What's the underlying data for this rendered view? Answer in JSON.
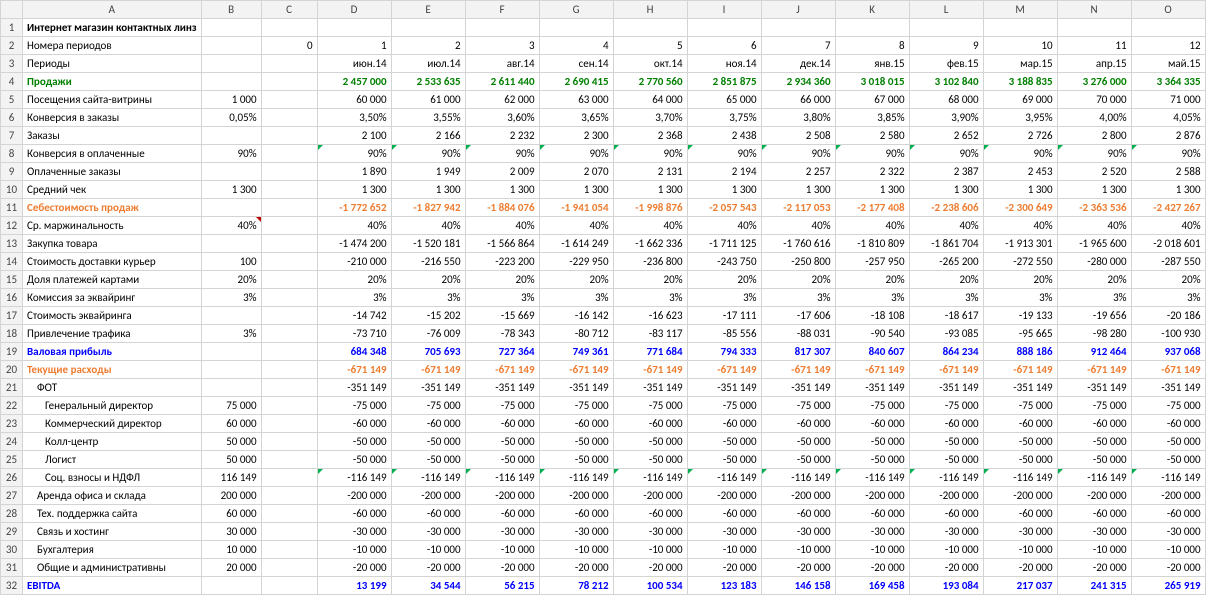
{
  "columns": [
    "",
    "A",
    "B",
    "C",
    "D",
    "E",
    "F",
    "G",
    "H",
    "I",
    "J",
    "K",
    "L",
    "M",
    "N",
    "O"
  ],
  "rows": {
    "1": {
      "A": "Интернет магазин контактных линз"
    },
    "2": {
      "A": "Номера периодов",
      "C": "0",
      "D": "1",
      "E": "2",
      "F": "3",
      "G": "4",
      "H": "5",
      "I": "6",
      "J": "7",
      "K": "8",
      "L": "9",
      "M": "10",
      "N": "11",
      "O": "12"
    },
    "3": {
      "A": "Периоды",
      "D": "июн.14",
      "E": "июл.14",
      "F": "авг.14",
      "G": "сен.14",
      "H": "окт.14",
      "I": "ноя.14",
      "J": "дек.14",
      "K": "янв.15",
      "L": "фев.15",
      "M": "мар.15",
      "N": "апр.15",
      "O": "май.15"
    },
    "4": {
      "A": "Продажи",
      "D": "2 457 000",
      "E": "2 533 635",
      "F": "2 611 440",
      "G": "2 690 415",
      "H": "2 770 560",
      "I": "2 851 875",
      "J": "2 934 360",
      "K": "3 018 015",
      "L": "3 102 840",
      "M": "3 188 835",
      "N": "3 276 000",
      "O": "3 364 335"
    },
    "5": {
      "A": "Посещения сайта-витрины",
      "B": "1 000",
      "D": "60 000",
      "E": "61 000",
      "F": "62 000",
      "G": "63 000",
      "H": "64 000",
      "I": "65 000",
      "J": "66 000",
      "K": "67 000",
      "L": "68 000",
      "M": "69 000",
      "N": "70 000",
      "O": "71 000"
    },
    "6": {
      "A": "Конверсия в заказы",
      "B": "0,05%",
      "D": "3,50%",
      "E": "3,55%",
      "F": "3,60%",
      "G": "3,65%",
      "H": "3,70%",
      "I": "3,75%",
      "J": "3,80%",
      "K": "3,85%",
      "L": "3,90%",
      "M": "3,95%",
      "N": "4,00%",
      "O": "4,05%"
    },
    "7": {
      "A": "Заказы",
      "D": "2 100",
      "E": "2 166",
      "F": "2 232",
      "G": "2 300",
      "H": "2 368",
      "I": "2 438",
      "J": "2 508",
      "K": "2 580",
      "L": "2 652",
      "M": "2 726",
      "N": "2 800",
      "O": "2 876"
    },
    "8": {
      "A": "Конверсия в оплаченные",
      "B": "90%",
      "D": "90%",
      "E": "90%",
      "F": "90%",
      "G": "90%",
      "H": "90%",
      "I": "90%",
      "J": "90%",
      "K": "90%",
      "L": "90%",
      "M": "90%",
      "N": "90%",
      "O": "90%"
    },
    "9": {
      "A": "Оплаченные заказы",
      "D": "1 890",
      "E": "1 949",
      "F": "2 009",
      "G": "2 070",
      "H": "2 131",
      "I": "2 194",
      "J": "2 257",
      "K": "2 322",
      "L": "2 387",
      "M": "2 453",
      "N": "2 520",
      "O": "2 588"
    },
    "10": {
      "A": "Средний чек",
      "B": "1 300",
      "D": "1 300",
      "E": "1 300",
      "F": "1 300",
      "G": "1 300",
      "H": "1 300",
      "I": "1 300",
      "J": "1 300",
      "K": "1 300",
      "L": "1 300",
      "M": "1 300",
      "N": "1 300",
      "O": "1 300"
    },
    "11": {
      "A": "Себестоимость продаж",
      "D": "-1 772 652",
      "E": "-1 827 942",
      "F": "-1 884 076",
      "G": "-1 941 054",
      "H": "-1 998 876",
      "I": "-2 057 543",
      "J": "-2 117 053",
      "K": "-2 177 408",
      "L": "-2 238 606",
      "M": "-2 300 649",
      "N": "-2 363 536",
      "O": "-2 427 267"
    },
    "12": {
      "A": "Ср. маржинальность",
      "B": "40%",
      "D": "40%",
      "E": "40%",
      "F": "40%",
      "G": "40%",
      "H": "40%",
      "I": "40%",
      "J": "40%",
      "K": "40%",
      "L": "40%",
      "M": "40%",
      "N": "40%",
      "O": "40%"
    },
    "13": {
      "A": "Закупка товара",
      "D": "-1 474 200",
      "E": "-1 520 181",
      "F": "-1 566 864",
      "G": "-1 614 249",
      "H": "-1 662 336",
      "I": "-1 711 125",
      "J": "-1 760 616",
      "K": "-1 810 809",
      "L": "-1 861 704",
      "M": "-1 913 301",
      "N": "-1 965 600",
      "O": "-2 018 601"
    },
    "14": {
      "A": "Стоимость доставки курьер",
      "B": "100",
      "D": "-210 000",
      "E": "-216 550",
      "F": "-223 200",
      "G": "-229 950",
      "H": "-236 800",
      "I": "-243 750",
      "J": "-250 800",
      "K": "-257 950",
      "L": "-265 200",
      "M": "-272 550",
      "N": "-280 000",
      "O": "-287 550"
    },
    "15": {
      "A": "Доля платежей картами",
      "B": "20%",
      "D": "20%",
      "E": "20%",
      "F": "20%",
      "G": "20%",
      "H": "20%",
      "I": "20%",
      "J": "20%",
      "K": "20%",
      "L": "20%",
      "M": "20%",
      "N": "20%",
      "O": "20%"
    },
    "16": {
      "A": "Комиссия за эквайринг",
      "B": "3%",
      "D": "3%",
      "E": "3%",
      "F": "3%",
      "G": "3%",
      "H": "3%",
      "I": "3%",
      "J": "3%",
      "K": "3%",
      "L": "3%",
      "M": "3%",
      "N": "3%",
      "O": "3%"
    },
    "17": {
      "A": "Стоимость эквайринга",
      "D": "-14 742",
      "E": "-15 202",
      "F": "-15 669",
      "G": "-16 142",
      "H": "-16 623",
      "I": "-17 111",
      "J": "-17 606",
      "K": "-18 108",
      "L": "-18 617",
      "M": "-19 133",
      "N": "-19 656",
      "O": "-20 186"
    },
    "18": {
      "A": "Привлечение трафика",
      "B": "3%",
      "D": "-73 710",
      "E": "-76 009",
      "F": "-78 343",
      "G": "-80 712",
      "H": "-83 117",
      "I": "-85 556",
      "J": "-88 031",
      "K": "-90 540",
      "L": "-93 085",
      "M": "-95 665",
      "N": "-98 280",
      "O": "-100 930"
    },
    "19": {
      "A": "Валовая прибыль",
      "D": "684 348",
      "E": "705 693",
      "F": "727 364",
      "G": "749 361",
      "H": "771 684",
      "I": "794 333",
      "J": "817 307",
      "K": "840 607",
      "L": "864 234",
      "M": "888 186",
      "N": "912 464",
      "O": "937 068"
    },
    "20": {
      "A": "Текущие расходы",
      "D": "-671 149",
      "E": "-671 149",
      "F": "-671 149",
      "G": "-671 149",
      "H": "-671 149",
      "I": "-671 149",
      "J": "-671 149",
      "K": "-671 149",
      "L": "-671 149",
      "M": "-671 149",
      "N": "-671 149",
      "O": "-671 149"
    },
    "21": {
      "A": "ФОТ",
      "D": "-351 149",
      "E": "-351 149",
      "F": "-351 149",
      "G": "-351 149",
      "H": "-351 149",
      "I": "-351 149",
      "J": "-351 149",
      "K": "-351 149",
      "L": "-351 149",
      "M": "-351 149",
      "N": "-351 149",
      "O": "-351 149"
    },
    "22": {
      "A": "Генеральный директор",
      "B": "75 000",
      "D": "-75 000",
      "E": "-75 000",
      "F": "-75 000",
      "G": "-75 000",
      "H": "-75 000",
      "I": "-75 000",
      "J": "-75 000",
      "K": "-75 000",
      "L": "-75 000",
      "M": "-75 000",
      "N": "-75 000",
      "O": "-75 000"
    },
    "23": {
      "A": "Коммерческий директор",
      "B": "60 000",
      "D": "-60 000",
      "E": "-60 000",
      "F": "-60 000",
      "G": "-60 000",
      "H": "-60 000",
      "I": "-60 000",
      "J": "-60 000",
      "K": "-60 000",
      "L": "-60 000",
      "M": "-60 000",
      "N": "-60 000",
      "O": "-60 000"
    },
    "24": {
      "A": "Колл-центр",
      "B": "50 000",
      "D": "-50 000",
      "E": "-50 000",
      "F": "-50 000",
      "G": "-50 000",
      "H": "-50 000",
      "I": "-50 000",
      "J": "-50 000",
      "K": "-50 000",
      "L": "-50 000",
      "M": "-50 000",
      "N": "-50 000",
      "O": "-50 000"
    },
    "25": {
      "A": "Логист",
      "B": "50 000",
      "D": "-50 000",
      "E": "-50 000",
      "F": "-50 000",
      "G": "-50 000",
      "H": "-50 000",
      "I": "-50 000",
      "J": "-50 000",
      "K": "-50 000",
      "L": "-50 000",
      "M": "-50 000",
      "N": "-50 000",
      "O": "-50 000"
    },
    "26": {
      "A": "Соц. взносы и НДФЛ",
      "B": "116 149",
      "D": "-116 149",
      "E": "-116 149",
      "F": "-116 149",
      "G": "-116 149",
      "H": "-116 149",
      "I": "-116 149",
      "J": "-116 149",
      "K": "-116 149",
      "L": "-116 149",
      "M": "-116 149",
      "N": "-116 149",
      "O": "-116 149"
    },
    "27": {
      "A": "Аренда офиса и склада",
      "B": "200 000",
      "D": "-200 000",
      "E": "-200 000",
      "F": "-200 000",
      "G": "-200 000",
      "H": "-200 000",
      "I": "-200 000",
      "J": "-200 000",
      "K": "-200 000",
      "L": "-200 000",
      "M": "-200 000",
      "N": "-200 000",
      "O": "-200 000"
    },
    "28": {
      "A": "Тех. поддержка сайта",
      "B": "60 000",
      "D": "-60 000",
      "E": "-60 000",
      "F": "-60 000",
      "G": "-60 000",
      "H": "-60 000",
      "I": "-60 000",
      "J": "-60 000",
      "K": "-60 000",
      "L": "-60 000",
      "M": "-60 000",
      "N": "-60 000",
      "O": "-60 000"
    },
    "29": {
      "A": "Связь и хостинг",
      "B": "30 000",
      "D": "-30 000",
      "E": "-30 000",
      "F": "-30 000",
      "G": "-30 000",
      "H": "-30 000",
      "I": "-30 000",
      "J": "-30 000",
      "K": "-30 000",
      "L": "-30 000",
      "M": "-30 000",
      "N": "-30 000",
      "O": "-30 000"
    },
    "30": {
      "A": "Бухгалтерия",
      "B": "10 000",
      "D": "-10 000",
      "E": "-10 000",
      "F": "-10 000",
      "G": "-10 000",
      "H": "-10 000",
      "I": "-10 000",
      "J": "-10 000",
      "K": "-10 000",
      "L": "-10 000",
      "M": "-10 000",
      "N": "-10 000",
      "O": "-10 000"
    },
    "31": {
      "A": "Общие и административны",
      "B": "20 000",
      "D": "-20 000",
      "E": "-20 000",
      "F": "-20 000",
      "G": "-20 000",
      "H": "-20 000",
      "I": "-20 000",
      "J": "-20 000",
      "K": "-20 000",
      "L": "-20 000",
      "M": "-20 000",
      "N": "-20 000",
      "O": "-20 000"
    },
    "32": {
      "A": "EBITDA",
      "D": "13 199",
      "E": "34 544",
      "F": "56 215",
      "G": "78 212",
      "H": "100 534",
      "I": "123 183",
      "J": "146 158",
      "K": "169 458",
      "L": "193 084",
      "M": "217 037",
      "N": "241 315",
      "O": "265 919"
    }
  },
  "style": {
    "boldRows": [
      "1",
      "4",
      "11",
      "19",
      "20",
      "32"
    ],
    "greenRows": [
      "4"
    ],
    "orangeRows": [
      "11",
      "20"
    ],
    "blueRows": [
      "19",
      "32"
    ],
    "indent1": [
      "21",
      "27",
      "28",
      "29",
      "30",
      "31"
    ],
    "indent2": [
      "22",
      "23",
      "24",
      "25",
      "26"
    ],
    "redTriCells": [
      [
        "12",
        "B"
      ]
    ],
    "grnTriRows": [
      "8",
      "26"
    ]
  }
}
